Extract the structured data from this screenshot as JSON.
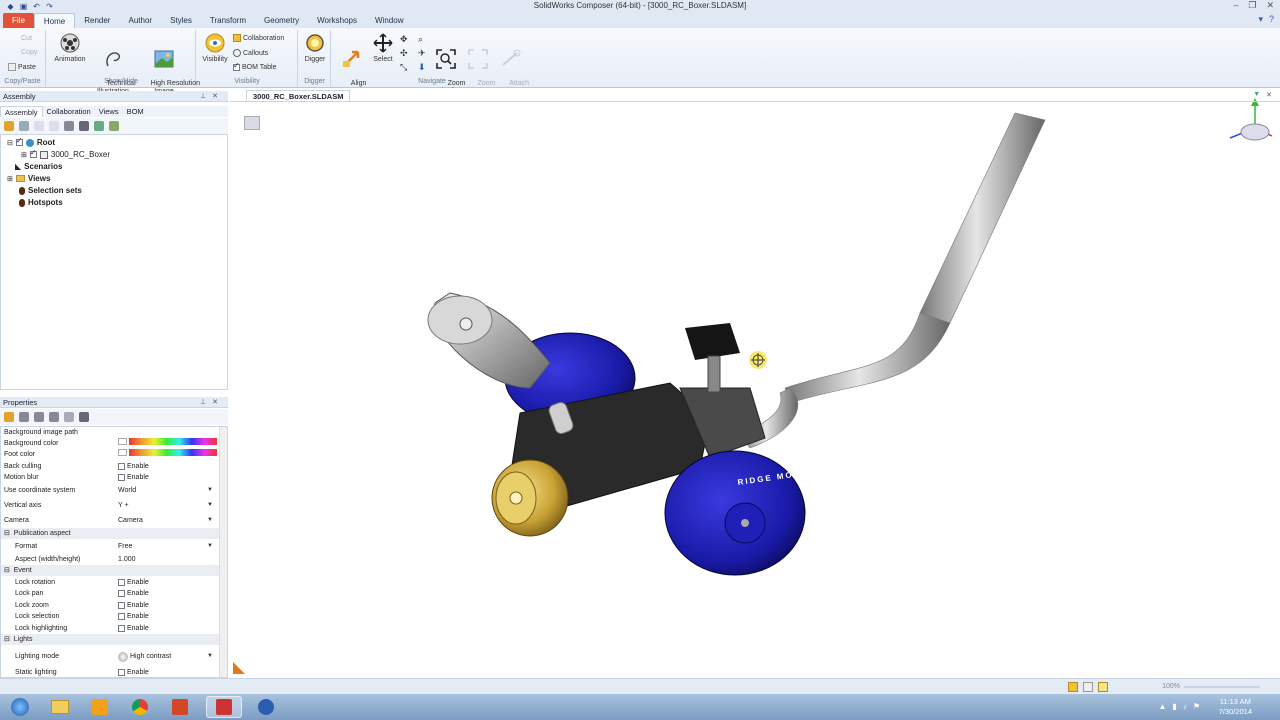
{
  "window": {
    "title": "SolidWorks Composer (64-bit) - [3000_RC_Boxer.SLDASM]"
  },
  "ribbon": {
    "tabs": [
      "File",
      "Home",
      "Render",
      "Author",
      "Styles",
      "Transform",
      "Geometry",
      "Workshops",
      "Window"
    ],
    "active_tab": "Home",
    "copypaste": {
      "cut": "Cut",
      "copy": "Copy",
      "paste": "Paste",
      "label": "Copy/Paste"
    },
    "showhide": {
      "animation": "Animation",
      "technical": "Technical\nIllustration",
      "highres": "High Resolution\nImage",
      "label": "Show/Hide"
    },
    "visibility": {
      "visibility": "Visibility",
      "collaboration": "Collaboration",
      "callouts": "Callouts",
      "bom_table": "BOM Table",
      "label": "Visibility"
    },
    "digger": {
      "digger": "Digger",
      "label": "Digger"
    },
    "navigate": {
      "align_camera": "Align\nCamera",
      "select": "Select",
      "zoom_fit": "Zoom\nFit All",
      "zoom_selection": "Zoom\nSelection",
      "attach_camera": "Attach\nCamera",
      "label": "Navigate"
    }
  },
  "assembly": {
    "title": "Assembly",
    "subtabs": [
      "Assembly",
      "Collaboration",
      "Views",
      "BOM"
    ],
    "tree": {
      "root": "Root",
      "model": "3000_RC_Boxer",
      "scenarios": "Scenarios",
      "views": "Views",
      "selection_sets": "Selection sets",
      "hotspots": "Hotspots"
    }
  },
  "properties": {
    "title": "Properties",
    "rows": [
      {
        "name": "Background image path",
        "value": ""
      },
      {
        "name": "Background color",
        "value": ""
      },
      {
        "name": "Foot color",
        "value": ""
      },
      {
        "name": "Back culling",
        "value": "Enable"
      },
      {
        "name": "Motion blur",
        "value": "Enable"
      },
      {
        "name": "Use coordinate system",
        "value": "World"
      },
      {
        "name": "Vertical axis",
        "value": "Y +"
      },
      {
        "name": "Camera",
        "value": "Camera"
      },
      {
        "name": "Publication aspect",
        "value": ""
      },
      {
        "name": "Format",
        "value": "Free"
      },
      {
        "name": "Aspect (width/height)",
        "value": "1.000"
      },
      {
        "name": "Event",
        "value": ""
      },
      {
        "name": "Lock rotation",
        "value": "Enable"
      },
      {
        "name": "Lock pan",
        "value": "Enable"
      },
      {
        "name": "Lock zoom",
        "value": "Enable"
      },
      {
        "name": "Lock selection",
        "value": "Enable"
      },
      {
        "name": "Lock highlighting",
        "value": "Enable"
      },
      {
        "name": "Lights",
        "value": ""
      },
      {
        "name": "Lighting mode",
        "value": "High contrast"
      },
      {
        "name": "Static lighting",
        "value": "Enable"
      }
    ]
  },
  "document": {
    "tab": "3000_RC_Boxer.SLDASM",
    "engine_text": "RIDGE MOTORWORKS HAWK"
  },
  "status": {
    "zoom": "100%"
  },
  "taskbar": {
    "time": "11:13 AM",
    "date": "7/30/2014"
  }
}
